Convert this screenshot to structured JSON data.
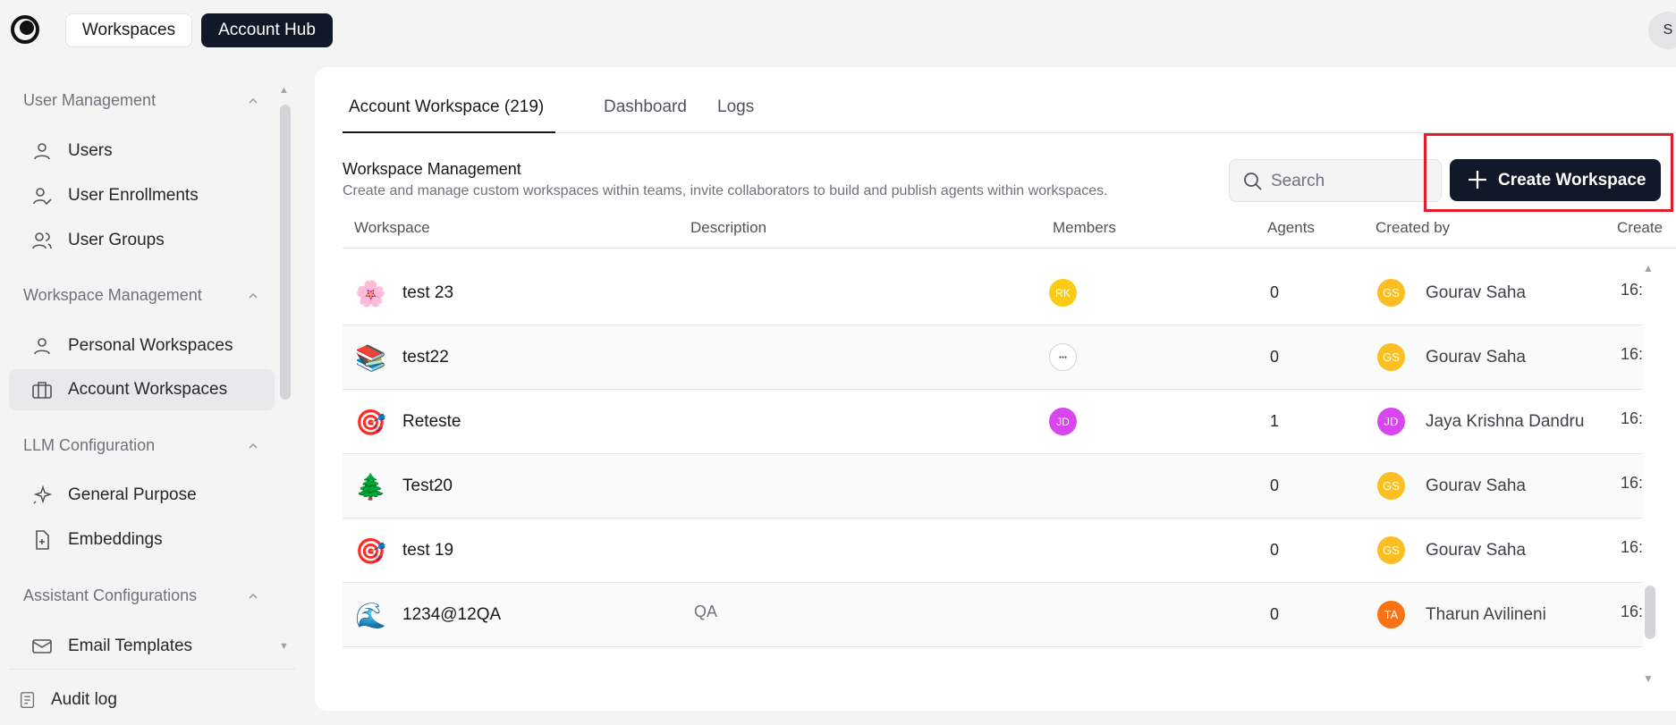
{
  "topbar": {
    "workspaces_label": "Workspaces",
    "account_hub_label": "Account Hub",
    "user_initial": "S"
  },
  "sidebar": {
    "sections": [
      {
        "title": "User Management",
        "items": [
          {
            "label": "Users",
            "icon": "user-icon"
          },
          {
            "label": "User Enrollments",
            "icon": "user-check-icon"
          },
          {
            "label": "User Groups",
            "icon": "users-icon"
          }
        ]
      },
      {
        "title": "Workspace Management",
        "items": [
          {
            "label": "Personal Workspaces",
            "icon": "user-icon"
          },
          {
            "label": "Account Workspaces",
            "icon": "briefcase-icon",
            "active": true
          }
        ]
      },
      {
        "title": "LLM Configuration",
        "items": [
          {
            "label": "General Purpose",
            "icon": "sparkles-icon"
          },
          {
            "label": "Embeddings",
            "icon": "file-plus-icon"
          }
        ]
      },
      {
        "title": "Assistant Configurations",
        "items": [
          {
            "label": "Email Templates",
            "icon": "mail-icon"
          }
        ]
      }
    ],
    "footer_item": {
      "label": "Audit log",
      "icon": "log-icon"
    }
  },
  "main": {
    "tabs": [
      {
        "label": "Account Workspace (219)",
        "active": true
      },
      {
        "label": "Dashboard"
      },
      {
        "label": "Logs"
      }
    ],
    "title": "Workspace Management",
    "subtitle": "Create and manage custom workspaces within teams, invite collaborators to build and publish agents within workspaces.",
    "search_placeholder": "Search",
    "create_label": "Create Workspace",
    "columns": [
      "Workspace",
      "Description",
      "Members",
      "Agents",
      "Created by",
      "Create"
    ],
    "rows": [
      {
        "emoji": "🌸",
        "name": "test 23",
        "description": "",
        "member": "RK",
        "member_color": "#facc15",
        "agents": "0",
        "creator_initials": "GS",
        "creator_color": "#fbbf24",
        "creator": "Gourav Saha",
        "created": "16:"
      },
      {
        "emoji": "📚",
        "name": "test22",
        "description": "",
        "member": "img",
        "member_color": "#ffffff",
        "agents": "0",
        "creator_initials": "GS",
        "creator_color": "#fbbf24",
        "creator": "Gourav Saha",
        "created": "16:"
      },
      {
        "emoji": "🎯",
        "name": "Reteste",
        "description": "",
        "member": "JD",
        "member_color": "#d946ef",
        "agents": "1",
        "creator_initials": "JD",
        "creator_color": "#d946ef",
        "creator": "Jaya Krishna Dandru",
        "created": "16:"
      },
      {
        "emoji": "🌲",
        "name": "Test20",
        "description": "",
        "member": "",
        "member_color": "",
        "agents": "0",
        "creator_initials": "GS",
        "creator_color": "#fbbf24",
        "creator": "Gourav Saha",
        "created": "16:"
      },
      {
        "emoji": "🎯",
        "name": "test 19",
        "description": "",
        "member": "",
        "member_color": "",
        "agents": "0",
        "creator_initials": "GS",
        "creator_color": "#fbbf24",
        "creator": "Gourav Saha",
        "created": "16:"
      },
      {
        "emoji": "🌊",
        "name": "1234@12QA",
        "description": "QA",
        "member": "",
        "member_color": "",
        "agents": "0",
        "creator_initials": "TA",
        "creator_color": "#f97316",
        "creator": "Tharun Avilineni",
        "created": "16:"
      }
    ]
  }
}
